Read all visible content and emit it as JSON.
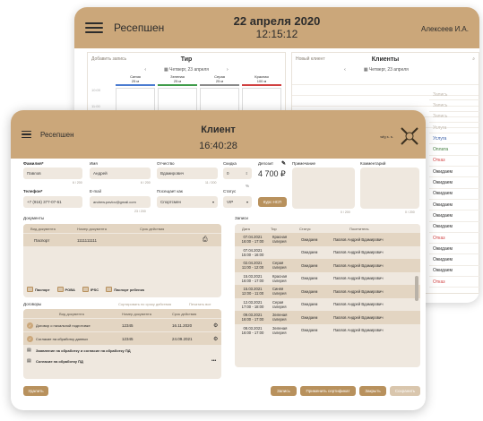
{
  "back": {
    "title": "Ресепшен",
    "date": "22 апреля 2020",
    "time": "12:15:12",
    "user": "Алексеев И.А.",
    "tir_panel": {
      "add_label": "Добавить запись",
      "title": "Тир",
      "date": "Четверг, 23 апреля",
      "lanes": [
        {
          "name": "Синяя",
          "size": "25 м",
          "color": "#4a7bd0"
        },
        {
          "name": "Зеленая",
          "size": "25 м",
          "color": "#3f9b4a"
        },
        {
          "name": "Серая",
          "size": "25 м",
          "color": "#8a8a8a"
        },
        {
          "name": "Красная",
          "size": "100 м",
          "color": "#d04040"
        }
      ],
      "times": [
        "10:00",
        "11:00"
      ]
    },
    "clients_panel": {
      "new_label": "Новый клиент",
      "title": "Клиенты",
      "date": "Четверг, 23 апреля"
    },
    "statuses": [
      {
        "text": "Запись",
        "color": "#c0b8ad"
      },
      {
        "text": "Запись",
        "color": "#c0b8ad"
      },
      {
        "text": "Запись",
        "color": "#c0b8ad"
      },
      {
        "text": "Услуга",
        "color": "#c0b8ad"
      },
      {
        "text": "Услуга",
        "color": "#3a5fa8"
      },
      {
        "text": "Оплата",
        "color": "#3f7a3a"
      },
      {
        "text": "Отказ",
        "color": "#d04040"
      },
      {
        "text": "Ожидаем",
        "color": "#2c2c2c"
      },
      {
        "text": "Ожидаем",
        "color": "#2c2c2c"
      },
      {
        "text": "Ожидаем",
        "color": "#2c2c2c"
      },
      {
        "text": "Ожидаем",
        "color": "#2c2c2c"
      },
      {
        "text": "Ожидаем",
        "color": "#2c2c2c"
      },
      {
        "text": "Ожидаем",
        "color": "#2c2c2c"
      },
      {
        "text": "Отказ",
        "color": "#d04040"
      },
      {
        "text": "Ожидаем",
        "color": "#2c2c2c"
      },
      {
        "text": "Ожидаем",
        "color": "#2c2c2c"
      },
      {
        "text": "Ожидаем",
        "color": "#2c2c2c"
      },
      {
        "text": "Отказ",
        "color": "#d04040"
      }
    ]
  },
  "front": {
    "title": "Ресепшен",
    "heading": "Клиент",
    "time": "16:40:28",
    "user": "wfg s. s.",
    "form": {
      "surname_label": "Фамилия*",
      "surname_value": "Павлов",
      "surname_hint": "6 / 200",
      "name_label": "Имя",
      "name_value": "Андрей",
      "name_hint": "6 / 200",
      "patronymic_label": "Отчество",
      "patronymic_value": "Вдамирович",
      "patronymic_hint": "11 / 200",
      "discount_label": "Скидка",
      "discount_value": "0",
      "discount_unit": "%",
      "deposit_label": "Депозит",
      "deposit_value": "4 700 ₽",
      "note_label": "Примечание",
      "note_hint": "0 / 200",
      "comment_label": "Комментарий",
      "comment_hint": "0 / 200",
      "phone_label": "Телефон*",
      "phone_value": "+7 (916) 377-07-61",
      "phone_hint": "16 / 200",
      "email_label": "E-mail",
      "email_value": "andrew.pavlov@gmail.com",
      "email_hint": "23 / 200",
      "visit_label": "Посещает как",
      "visit_value": "Спортсмен",
      "status_label": "Статус",
      "status_value": "VIP",
      "course_button": "Курс НСП"
    },
    "documents": {
      "label": "Документы",
      "headers": [
        "Вид документа",
        "Номер документа",
        "Срок действия"
      ],
      "rows": [
        {
          "type": "Паспорт",
          "number": "1111111111",
          "expiry": ""
        }
      ],
      "chips": [
        "Паспорт",
        "РОВА",
        "IPSC",
        "Паспорт ребенка"
      ]
    },
    "contracts": {
      "label": "Договоры",
      "sort_link": "Сортировать по сроку действия",
      "print_link": "Печатать все",
      "headers": [
        "Вид документа",
        "Номер документа",
        "Срок действия"
      ],
      "rows": [
        {
          "type": "Договор о начальной подготовке",
          "number": "12345",
          "expiry": "16.11.2020"
        },
        {
          "type": "Согласие на обработку данных",
          "number": "12345",
          "expiry": "24.09.2021"
        }
      ],
      "extra": [
        "Заявление на обработку и согласие на обработку ПД",
        "Согласие на обработку ПД"
      ]
    },
    "records": {
      "label": "Записи",
      "headers": [
        "Дата",
        "Тир",
        "Статус",
        "Посетитель"
      ],
      "rows": [
        {
          "date": "07.04.2021",
          "time": "16:00 - 17:00",
          "tir": "Красная галерея",
          "status": "Ожидаем",
          "visitor": "Павлов Андрей Вдамирович"
        },
        {
          "date": "07.04.2021",
          "time": "15:00 - 16:00",
          "tir": "",
          "status": "Ожидаем",
          "visitor": "Павлов Андрей Вдамирович"
        },
        {
          "date": "02.04.2021",
          "time": "11:00 - 12:00",
          "tir": "Серая галерея",
          "status": "Ожидаем",
          "visitor": "Павлов Андрей Вдамирович"
        },
        {
          "date": "15.03.2021",
          "time": "16:00 - 17:00",
          "tir": "Красная галерея",
          "status": "Ожидаем",
          "visitor": "Павлов Андрей Вдамирович"
        },
        {
          "date": "15.03.2021",
          "time": "12:00 - 11:00",
          "tir": "Синяя галерея",
          "status": "Ожидаем",
          "visitor": "Павлов Андрей Вдамирович"
        },
        {
          "date": "12.03.2021",
          "time": "17:00 - 18:00",
          "tir": "Серая галерея",
          "status": "Ожидаем",
          "visitor": "Павлов Андрей Вдамирович"
        },
        {
          "date": "09.03.2021",
          "time": "16:00 - 17:00",
          "tir": "Зеленая галерея",
          "status": "Ожидаем",
          "visitor": "Павлов Андрей Вдамирович"
        },
        {
          "date": "08.03.2021",
          "time": "16:00 - 17:00",
          "tir": "Зеленая галерея",
          "status": "Ожидаем",
          "visitor": "Павлов Андрей Вдамирович"
        }
      ]
    },
    "buttons": {
      "delete": "Удалить",
      "record": "Запись",
      "certificate": "Применить сертификат",
      "close": "Закрыть",
      "save": "Сохранить"
    }
  }
}
